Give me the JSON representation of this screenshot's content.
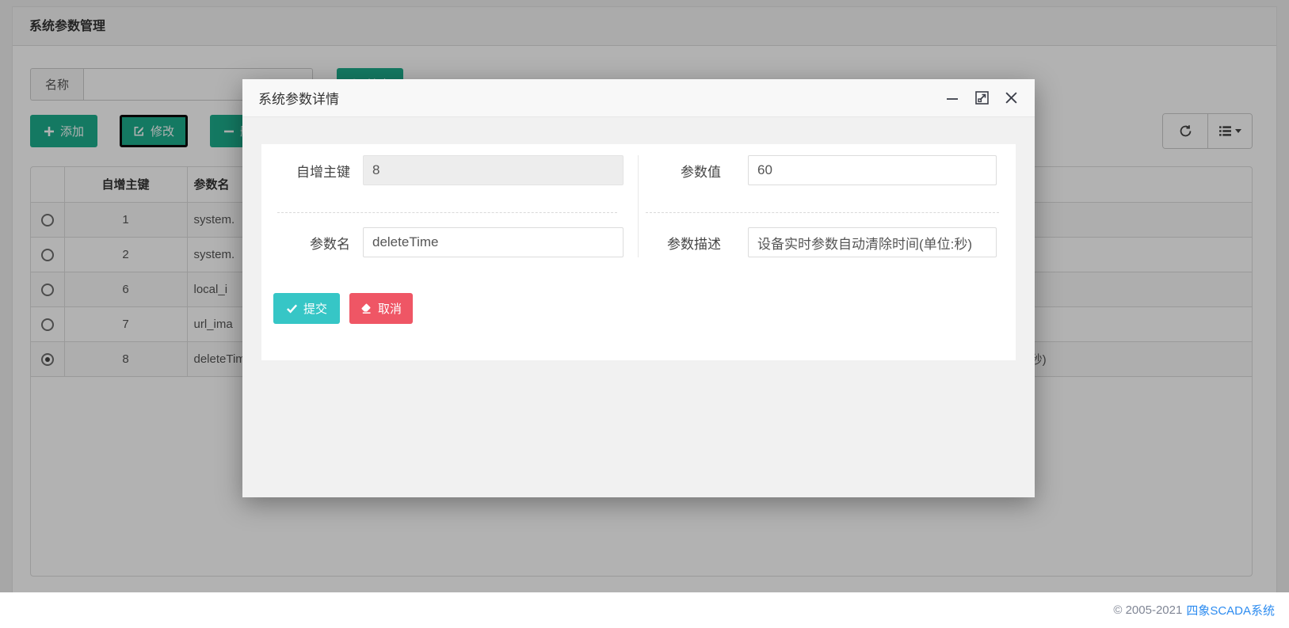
{
  "page": {
    "title": "系统参数管理"
  },
  "toolbar": {
    "search_label": "名称",
    "search_value": "",
    "search_button": "搜索",
    "add_button": "添加",
    "edit_button": "修改",
    "delete_button": "删除"
  },
  "table": {
    "columns": {
      "select": "",
      "id": "自增主键",
      "name": "参数名",
      "value": "",
      "desc": ""
    },
    "rows": [
      {
        "selected": false,
        "id": "1",
        "name": "system.",
        "value": "",
        "desc": ""
      },
      {
        "selected": false,
        "id": "2",
        "name": "system.",
        "value": "",
        "desc": ""
      },
      {
        "selected": false,
        "id": "6",
        "name": "local_i",
        "value": "",
        "desc": ""
      },
      {
        "selected": false,
        "id": "7",
        "name": "url_ima",
        "value": "",
        "desc": ""
      },
      {
        "selected": true,
        "id": "8",
        "name": "deleteTime",
        "value": "",
        "desc": "设备实时参数自动清除时间(单位:秒)"
      }
    ]
  },
  "modal": {
    "title": "系统参数详情",
    "fields": {
      "id": {
        "label": "自增主键",
        "value": "8"
      },
      "value": {
        "label": "参数值",
        "value": "60"
      },
      "name": {
        "label": "参数名",
        "value": "deleteTime"
      },
      "desc": {
        "label": "参数描述",
        "value": "设备实时参数自动清除时间(单位:秒)"
      }
    },
    "submit_button": "提交",
    "cancel_button": "取消"
  },
  "footer": {
    "copyright": "© 2005-2021",
    "brand": "四象SCADA系统"
  },
  "colors": {
    "green": "#1eae8d",
    "teal": "#36c6c6",
    "red": "#ef5665",
    "link_blue": "#2d8cf0"
  }
}
